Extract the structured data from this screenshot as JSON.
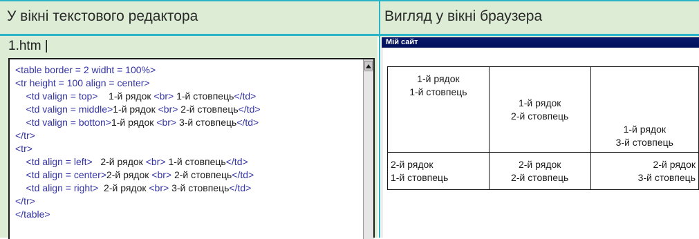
{
  "header": {
    "left_title": "У вікні текстового редактора",
    "right_title": "Вигляд у вікні браузера"
  },
  "editor": {
    "filename": "1.htm |",
    "lines": [
      [
        {
          "t": "tag",
          "v": "<table border = 2 widht = 100%>"
        }
      ],
      [
        {
          "t": "tag",
          "v": "<tr height = 100 align = center>"
        }
      ],
      [
        {
          "t": "tag",
          "v": "    <td valign = top>"
        },
        {
          "t": "txt",
          "v": "    1-й рядок "
        },
        {
          "t": "tag",
          "v": "<br>"
        },
        {
          "t": "txt",
          "v": " 1-й стовпець"
        },
        {
          "t": "tag",
          "v": "</td>"
        }
      ],
      [
        {
          "t": "tag",
          "v": "    <td valign = middle>"
        },
        {
          "t": "txt",
          "v": "1-й рядок "
        },
        {
          "t": "tag",
          "v": "<br>"
        },
        {
          "t": "txt",
          "v": " 2-й стовпець"
        },
        {
          "t": "tag",
          "v": "</td>"
        }
      ],
      [
        {
          "t": "tag",
          "v": "    <td valign = botton>"
        },
        {
          "t": "txt",
          "v": "1-й рядок "
        },
        {
          "t": "tag",
          "v": "<br>"
        },
        {
          "t": "txt",
          "v": " 3-й стовпець"
        },
        {
          "t": "tag",
          "v": "</td>"
        }
      ],
      [
        {
          "t": "tag",
          "v": "</tr>"
        }
      ],
      [
        {
          "t": "tag",
          "v": "<tr>"
        }
      ],
      [
        {
          "t": "tag",
          "v": "    <td align = left>"
        },
        {
          "t": "txt",
          "v": "   2-й рядок "
        },
        {
          "t": "tag",
          "v": "<br>"
        },
        {
          "t": "txt",
          "v": " 1-й стовпець"
        },
        {
          "t": "tag",
          "v": "</td>"
        }
      ],
      [
        {
          "t": "tag",
          "v": "    <td align = center>"
        },
        {
          "t": "txt",
          "v": "2-й рядок "
        },
        {
          "t": "tag",
          "v": "<br>"
        },
        {
          "t": "txt",
          "v": " 2-й стовпець"
        },
        {
          "t": "tag",
          "v": "</td>"
        }
      ],
      [
        {
          "t": "tag",
          "v": "    <td align = right>"
        },
        {
          "t": "txt",
          "v": "  2-й рядок "
        },
        {
          "t": "tag",
          "v": "<br>"
        },
        {
          "t": "txt",
          "v": " 3-й стовпець"
        },
        {
          "t": "tag",
          "v": "</td>"
        }
      ],
      [
        {
          "t": "tag",
          "v": "</tr>"
        }
      ],
      [
        {
          "t": "tag",
          "v": "</table>"
        }
      ]
    ]
  },
  "browser": {
    "window_title": "Мій сайт",
    "table": {
      "row1": [
        {
          "line1": "1-й рядок",
          "line2": "1-й стовпець"
        },
        {
          "line1": "1-й рядок",
          "line2": "2-й стовпець"
        },
        {
          "line1": "1-й рядок",
          "line2": "3-й стовпець"
        }
      ],
      "row2": [
        {
          "line1": "2-й рядок",
          "line2": "1-й стовпець"
        },
        {
          "line1": "2-й рядок",
          "line2": "2-й стовпець"
        },
        {
          "line1": "2-й рядок",
          "line2": "3-й стовпець"
        }
      ]
    }
  },
  "icons": {
    "scroll_up": "scroll-up-arrow-icon"
  },
  "colors": {
    "accent": "#2bb3c8",
    "panel_bg": "#dcecd5",
    "tag_color": "#3333a6",
    "titlebar": "#00105a"
  }
}
